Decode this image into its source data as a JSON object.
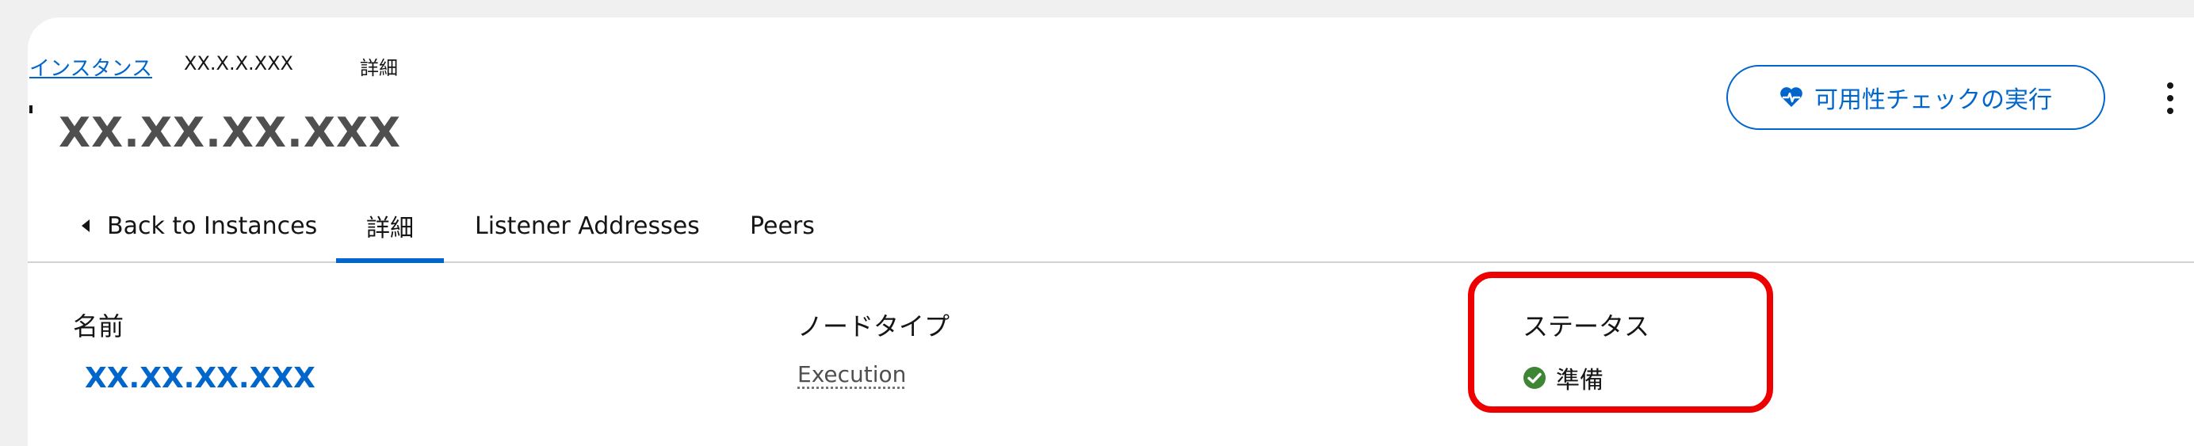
{
  "breadcrumb": {
    "parent_label": "インスタンス",
    "current_instance": "XX.X.X.XXX",
    "current_page": "詳細"
  },
  "page_title": "XX.XX.XX.XXX",
  "header_actions": {
    "run_health_check_label": "可用性チェックの実行"
  },
  "tabs": [
    {
      "label": "Back to Instances"
    },
    {
      "label": "詳細"
    },
    {
      "label": "Listener Addresses"
    },
    {
      "label": "Peers"
    }
  ],
  "details": {
    "name": {
      "label": "名前",
      "value": "XX.XX.XX.XXX"
    },
    "node_type": {
      "label": "ノードタイプ",
      "value": "Execution"
    },
    "status": {
      "label": "ステータス",
      "value": "準備"
    }
  },
  "colors": {
    "accent": "#0066cc",
    "status_ok": "#3e8635",
    "highlight": "#ee0000"
  }
}
